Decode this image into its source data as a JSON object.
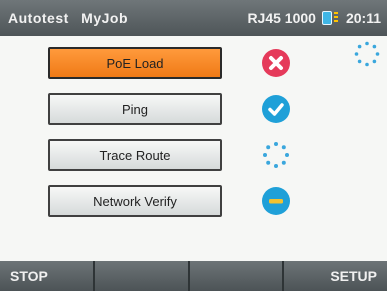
{
  "header": {
    "mode": "Autotest",
    "job": "MyJob",
    "interface": "RJ45 1000",
    "time": "20:11",
    "battery_icon": "battery-icon"
  },
  "tests": [
    {
      "label": "PoE Load",
      "status": "fail",
      "status_icon": "fail-x-icon"
    },
    {
      "label": "Ping",
      "status": "pass",
      "status_icon": "pass-check-icon"
    },
    {
      "label": "Trace Route",
      "status": "pending",
      "status_icon": "pending-spinner-icon"
    },
    {
      "label": "Network Verify",
      "status": "blocked",
      "status_icon": "blocked-minus-icon"
    }
  ],
  "softkeys": {
    "k1": "STOP",
    "k2": "",
    "k3": "",
    "k4": "SETUP"
  },
  "colors": {
    "active_button": "#f07a16",
    "fail": "#e53a5a",
    "pass": "#1fa0d8",
    "header_bg": "#5b6265"
  }
}
